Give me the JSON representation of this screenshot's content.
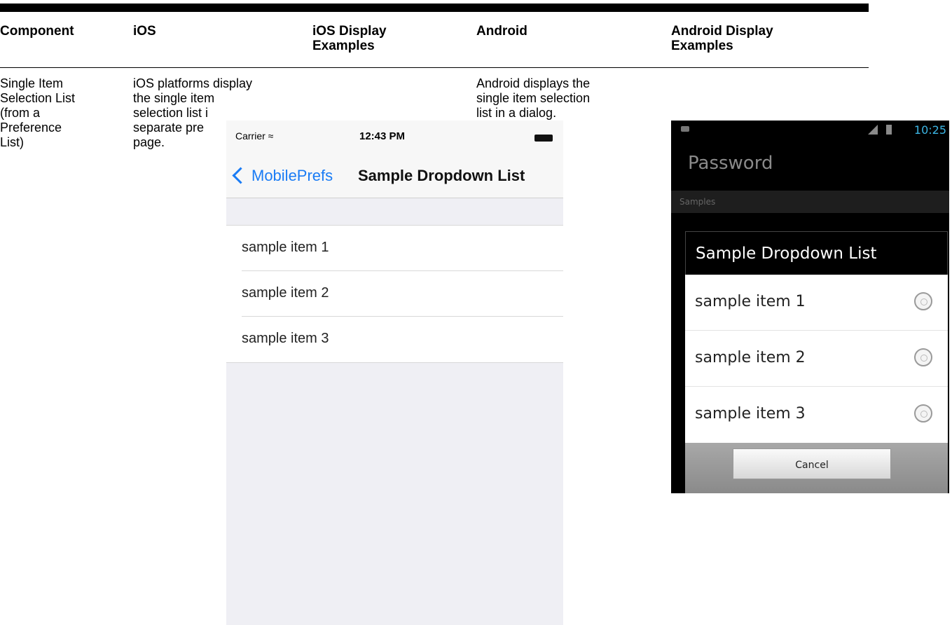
{
  "headers": [
    "Component",
    "iOS",
    "iOS Display\nExamples",
    "Android",
    "Android Display\nExamples"
  ],
  "row": {
    "component": [
      "Single Item",
      "Selection List",
      "(from a",
      "Preference",
      "List)"
    ],
    "ios_text": [
      "iOS platforms display",
      "the single item",
      "selection list i",
      "separate pre",
      "page."
    ],
    "android_text": [
      "Android displays the",
      "single item selection",
      "list in a dialog."
    ]
  },
  "ios_screen": {
    "carrier": "Carrier",
    "time": "12:43 PM",
    "back_label": "MobilePrefs",
    "title": "Sample Dropdown List",
    "items": [
      "sample item 1",
      "sample item 2",
      "sample item 3"
    ],
    "accent": "#1a7cf5"
  },
  "android_screen": {
    "time": "10:25",
    "app_title": "Password",
    "section": "Samples",
    "dialog_title": "Sample Dropdown List",
    "items": [
      "sample item 1",
      "sample item 2",
      "sample item 3"
    ],
    "cancel_label": "Cancel",
    "accent": "#3cb6e5"
  }
}
